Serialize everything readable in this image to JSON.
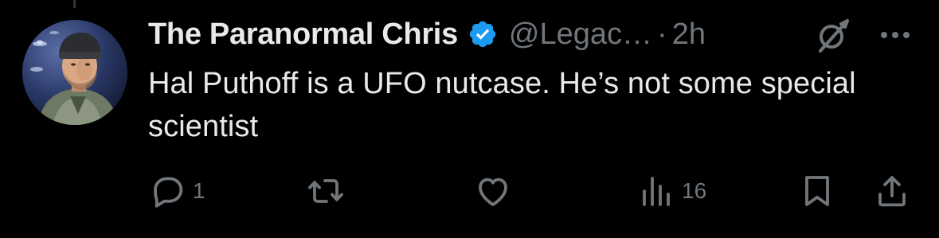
{
  "tweet": {
    "display_name": "The Paranormal Chris",
    "verified": true,
    "handle": "@Legac…",
    "separator": "·",
    "time": "2h",
    "text": "Hal Puthoff is a UFO nutcase. He’s not some special scientist",
    "avatar_icon": "profile-photo-man-in-beanie"
  },
  "actions": {
    "reply_count": "1",
    "repost_count": "",
    "like_count": "",
    "views_count": "16"
  },
  "icons": {
    "verified": "verified-badge-icon",
    "grok": "grok-icon",
    "more": "more-icon",
    "reply": "reply-icon",
    "repost": "repost-icon",
    "like": "like-icon",
    "views": "views-icon",
    "bookmark": "bookmark-icon",
    "share": "share-icon"
  },
  "colors": {
    "background": "#000000",
    "text_primary": "#e7e9ea",
    "text_secondary": "#71767b",
    "verified_blue": "#1d9bf0"
  }
}
